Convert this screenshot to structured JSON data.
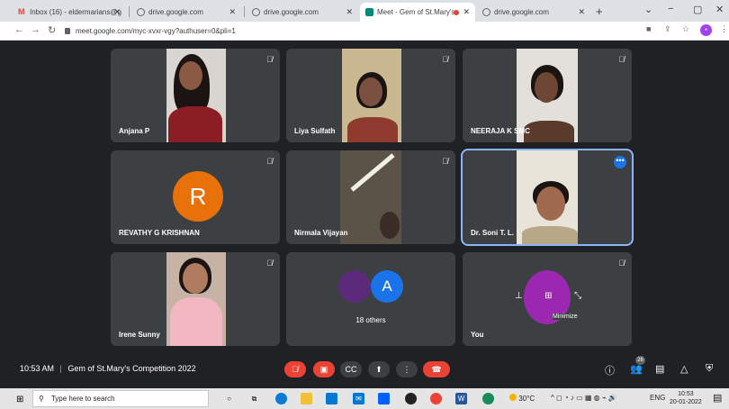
{
  "browser": {
    "tabs": [
      {
        "title": "Inbox (16) - eldermarians@g",
        "icon": "gmail-icon"
      },
      {
        "title": "drive.google.com",
        "icon": "drive-icon"
      },
      {
        "title": "drive.google.com",
        "icon": "drive-icon"
      },
      {
        "title": "Meet - Gem of St.Mary's",
        "icon": "meet-icon"
      },
      {
        "title": "drive.google.com",
        "icon": "drive-icon"
      }
    ],
    "url": "meet.google.com/myc-xvxr-vgy?authuser=0&pli=1"
  },
  "participants": [
    {
      "name": "Anjana P",
      "type": "video"
    },
    {
      "name": "Liya Sulfath",
      "type": "video"
    },
    {
      "name": "NEERAJA K SMC",
      "type": "video"
    },
    {
      "name": "REVATHY G KRISHNAN",
      "type": "avatar",
      "initial": "R"
    },
    {
      "name": "Nirmala Vijayan",
      "type": "video"
    },
    {
      "name": "Dr. Soni T. L.",
      "type": "video",
      "active": true
    },
    {
      "name": "Irene Sunny",
      "type": "video"
    }
  ],
  "others": {
    "label": "18 others",
    "initial": "A"
  },
  "self": {
    "name": "You",
    "tooltip": "Minimize"
  },
  "meeting": {
    "time": "10:53 AM",
    "separator": "|",
    "title": "Gem of St.Mary's Competition 2022"
  },
  "people_count": "26",
  "taskbar": {
    "search_placeholder": "Type here to search",
    "weather": "30°C",
    "lang": "ENG",
    "time": "10:53",
    "date": "20-01-2022"
  },
  "colors": {
    "accent": "#1a73e8",
    "danger": "#ea4335",
    "avatar_r": "#e8710a",
    "self_avatar": "#9c27b0"
  }
}
